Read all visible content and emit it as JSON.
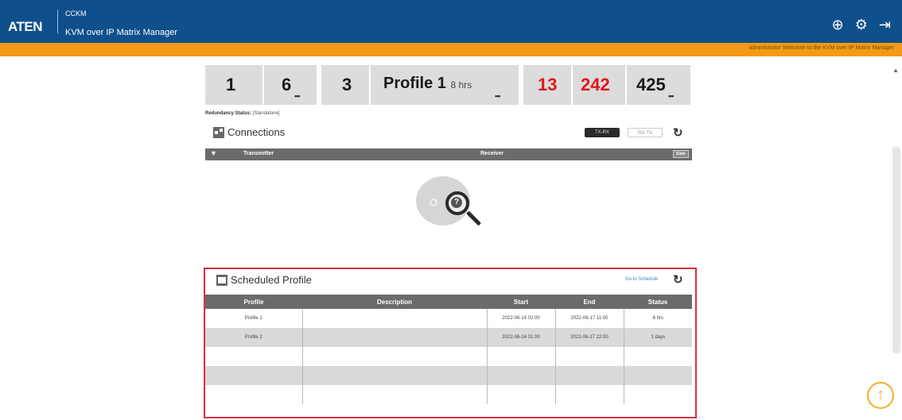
{
  "header": {
    "logo": "ATEN",
    "app_short": "CCKM",
    "app_full": "KVM over IP Matrix Manager",
    "icons": [
      "add-circle-icon",
      "gear-icon",
      "logout-icon"
    ]
  },
  "welcome_bar": {
    "text": "administrator Welcome to the KVM over IP Matrix Manager",
    "color": "#f39a16"
  },
  "stats": {
    "box1": {
      "a": "1",
      "b": "6",
      "more": "•••"
    },
    "box2": {
      "count": "3",
      "profile": "Profile 1",
      "hours": "8 hrs",
      "more": "•••"
    },
    "box3": {
      "a": "13",
      "b": "242",
      "c": "425",
      "more": "•••",
      "alert_color": "#e01818"
    }
  },
  "redundancy": {
    "label": "Redundancy Status:",
    "value": "[Standalone]"
  },
  "connections": {
    "title": "Connections",
    "btn_txrx": "TX-RX",
    "btn_rxtx": "RX-TX",
    "col_transmitter": "Transmitter",
    "col_receiver": "Receiver",
    "slide_label": "Slide"
  },
  "scheduled": {
    "title": "Scheduled Profile",
    "goto_label": "Go to Schedule",
    "columns": [
      "Profile",
      "Description",
      "Start",
      "End",
      "Status"
    ],
    "rows": [
      [
        "Profile 1",
        "",
        "2022-06-14 02:00",
        "2022-06-17 11:00",
        "8 hrs"
      ],
      [
        "Profile 2",
        "",
        "2022-06-14 01:00",
        "2022-06-17 22:00",
        "1 days"
      ],
      [
        "",
        "",
        "",
        "",
        ""
      ],
      [
        "",
        "",
        "",
        "",
        ""
      ],
      [
        "",
        "",
        "",
        "",
        ""
      ]
    ]
  },
  "scroll_top_icon": "arrow-up-icon"
}
